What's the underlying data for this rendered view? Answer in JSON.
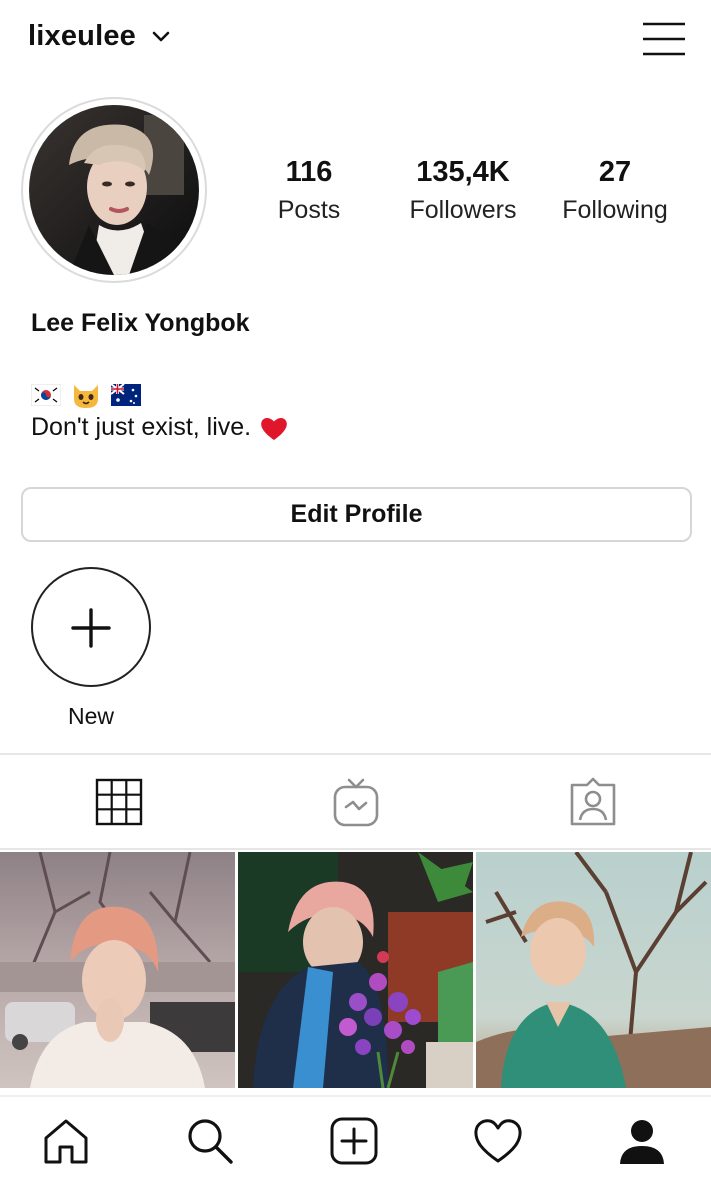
{
  "header": {
    "username": "lixeulee",
    "dropdown_icon": "chevron-down-icon",
    "menu_icon": "hamburger-menu-icon"
  },
  "profile": {
    "stats": [
      {
        "value": "116",
        "label": "Posts"
      },
      {
        "value": "135,4K",
        "label": "Followers"
      },
      {
        "value": "27",
        "label": "Following"
      }
    ],
    "full_name": "Lee Felix Yongbok",
    "bio_emojis": [
      "south-korea-flag",
      "cat-face",
      "australia-flag"
    ],
    "bio_text": "Don't just exist, live.",
    "bio_emoji_end": "red-heart"
  },
  "edit_profile_label": "Edit Profile",
  "highlights": [
    {
      "label": "New",
      "icon": "plus-icon"
    }
  ],
  "tabs": [
    {
      "name": "grid",
      "icon": "grid-icon",
      "active": true
    },
    {
      "name": "igtv",
      "icon": "igtv-icon",
      "active": false
    },
    {
      "name": "tagged",
      "icon": "tagged-person-icon",
      "active": false
    }
  ],
  "bottom_nav": [
    {
      "name": "home",
      "icon": "home-icon"
    },
    {
      "name": "search",
      "icon": "search-icon"
    },
    {
      "name": "new-post",
      "icon": "add-post-icon"
    },
    {
      "name": "activity",
      "icon": "heart-icon"
    },
    {
      "name": "profile",
      "icon": "profile-icon"
    }
  ],
  "colors": {
    "heart": "#e0172b",
    "border": "#dbdbdb",
    "icon_gray": "#8e8e8e"
  }
}
